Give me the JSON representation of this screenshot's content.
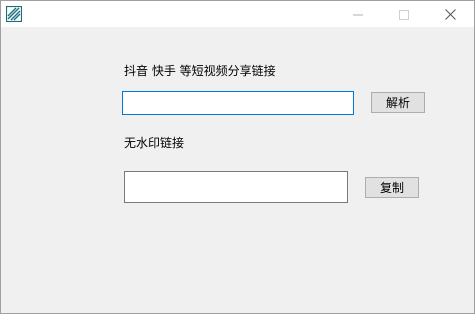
{
  "window": {
    "app_icon": "app-logo-icon",
    "controls": {
      "minimize_icon": "minimize-icon",
      "maximize_icon": "maximize-icon",
      "close_icon": "close-icon"
    }
  },
  "form": {
    "share_link_label": "抖音 快手 等短视频分享链接",
    "share_link_value": "",
    "parse_button": "解析",
    "no_watermark_label": "无水印链接",
    "result_value": "",
    "copy_button": "复制"
  },
  "colors": {
    "focus_border": "#0078d7",
    "window_bg": "#f0f0f0",
    "icon_accent": "#1a6f7a"
  }
}
